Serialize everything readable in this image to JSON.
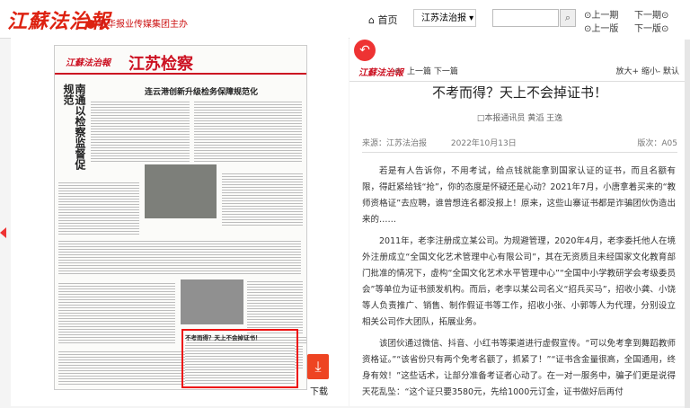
{
  "header": {
    "logo": "江蘇法治報",
    "subtitle": "新华报业传媒集团主办",
    "home": "首页",
    "select_value": "江苏法治报 ▾",
    "search_placeholder": "",
    "nav": {
      "prev_page": "上一期",
      "next_page": "下一期",
      "prev_ban": "上一版",
      "next_ban": "下一版"
    }
  },
  "newspaper": {
    "logo": "江蘇法治報",
    "section": "江苏检察",
    "headline1": "连云港创新升级检务保障规范化",
    "headline2": "南通以检察监督促规范",
    "headline3": "不考而得？天上不会掉证书！",
    "download": "下载"
  },
  "article": {
    "logo": "江蘇法治報",
    "nav_prev": "上一篇",
    "nav_next": "下一篇",
    "zoom_in": "放大+",
    "zoom_out": "缩小-",
    "zoom_default": "默认",
    "title": "不考而得？天上不会掉证书！",
    "byline": "□本报通讯员 黄滔 王逸",
    "source": "来源：江苏法治报",
    "date": "2022年10月13日",
    "edition": "版次：A05",
    "paragraphs": [
      "若是有人告诉你，不用考试，给点钱就能拿到国家认证的证书，而且名额有限，得赶紧给钱“抢”，你的态度是怀疑还是心动？2021年7月，小唐拿着买来的“教师资格证”去应聘，谁曾想连名都没报上！原来，这些山寨证书都是诈骗团伙伪造出来的……",
      "2011年，老李注册成立某公司。为规避管理，2020年4月，老李委托他人在境外注册成立“全国文化艺术管理中心有限公司”，其在无资质且未经国家文化教育部门批准的情况下，虚构“全国文化艺术水平管理中心”“全国中小学教研学会考级委员会”等单位为证书颁发机构。而后，老李以某公司名义“招兵买马”，招收小龚、小饶等人负责推广、销售、制作假证书等工作，招收小张、小郭等人为代理，分别设立相关公司作大团队，拓展业务。",
      "该团伙通过微信、抖音、小红书等渠道进行虚假宣传。“可以免考拿到舞蹈教师资格证。”“该省份只有两个免考名额了，抓紧了！”“证书含金量很高，全国通用，终身有效！”这些话术，让部分准备考证者心动了。在一对一服务中，骗子们更是说得天花乱坠：“这个证只要3580元，先给1000元订金，证书做好后再付"
    ]
  }
}
